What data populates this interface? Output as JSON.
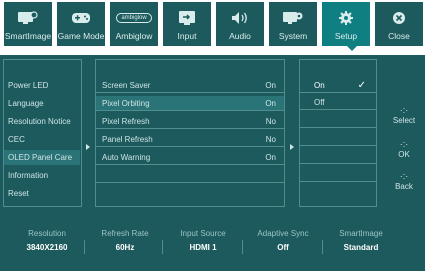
{
  "top_menu": [
    {
      "label": "SmartImage",
      "icon": "smartimage-icon"
    },
    {
      "label": "Game Mode",
      "icon": "gamepad-icon"
    },
    {
      "label": "Ambiglow",
      "icon": "ambiglow-icon",
      "icon_text": "ambiglow"
    },
    {
      "label": "Input",
      "icon": "input-icon"
    },
    {
      "label": "Audio",
      "icon": "speaker-icon"
    },
    {
      "label": "System",
      "icon": "system-icon"
    },
    {
      "label": "Setup",
      "icon": "gear-icon",
      "active": true
    },
    {
      "label": "Close",
      "icon": "close-icon"
    }
  ],
  "left_menu": [
    "Power LED",
    "Language",
    "Resolution Notice",
    "CEC",
    "OLED Panel Care",
    "Information",
    "Reset"
  ],
  "left_selected_index": 4,
  "middle_menu": [
    {
      "label": "Screen Saver",
      "value": "On"
    },
    {
      "label": "Pixel Orbiting",
      "value": "On"
    },
    {
      "label": "Pixel Refresh",
      "value": "No"
    },
    {
      "label": "Panel Refresh",
      "value": "No"
    },
    {
      "label": "Auto Warning",
      "value": "On"
    }
  ],
  "middle_selected_index": 1,
  "right_options": [
    "On",
    "Off"
  ],
  "right_checked_index": 0,
  "nav": {
    "select_label": "Select",
    "ok_label": "OK",
    "back_label": "Back"
  },
  "status": [
    {
      "label": "Resolution",
      "value": "3840X2160"
    },
    {
      "label": "Refresh Rate",
      "value": "60Hz"
    },
    {
      "label": "Input Source",
      "value": "HDMI 1"
    },
    {
      "label": "Adaptive Sync",
      "value": "Off"
    },
    {
      "label": "SmartImage",
      "value": "Standard"
    }
  ],
  "colors": {
    "osd_bg": "#1c5a5d",
    "active_tab": "#0f7f82",
    "text": "#cfe5e6",
    "border": "#4f8d8f"
  }
}
